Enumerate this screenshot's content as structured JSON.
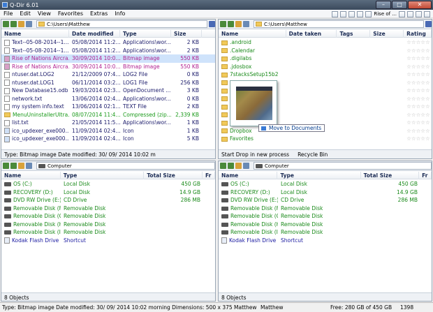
{
  "app": {
    "title": "Q-Dir 6.01"
  },
  "menu": [
    "File",
    "Edit",
    "View",
    "Favorites",
    "Extras",
    "Info"
  ],
  "top_toolbar": {
    "rise_label": "Rise of ..."
  },
  "colors": {
    "exe": "#1a1aa0",
    "bitmap": "#b02090",
    "app": "#2a2a9a",
    "zip": "#1a9a1a",
    "drive": "#1a8a1a",
    "shortcut": "#1a1aa0",
    "default": "#1a1a6a",
    "selection": "#cfe3fb"
  },
  "pane_tl": {
    "address": "C:\\Users\\Matthew",
    "headers": {
      "name": "Name",
      "date": "Date modified",
      "type": "Type",
      "size": "Size"
    },
    "rows": [
      {
        "name": "Text--05-08-2014--1...",
        "date": "05/08/2014 11:2...",
        "type": "Applications\\wor...",
        "size": "2 KB",
        "kind": "text",
        "color": "#1a1a6a"
      },
      {
        "name": "Text--05-08-2014--1...",
        "date": "05/08/2014 11:2...",
        "type": "Applications\\wor...",
        "size": "2 KB",
        "kind": "text",
        "color": "#1a1a6a"
      },
      {
        "name": "Rise of Nations Aircra...",
        "date": "30/09/2014 10:0...",
        "type": "Bitmap image",
        "size": "550 KB",
        "kind": "bitmap",
        "color": "#b02090"
      },
      {
        "name": "Rise of Nations Aircra...",
        "date": "30/09/2014 10:0...",
        "type": "Bitmap image",
        "size": "550 KB",
        "kind": "bitmap",
        "color": "#b02090"
      },
      {
        "name": "ntuser.dat.LOG2",
        "date": "21/12/2009 07:4...",
        "type": "LOG2 File",
        "size": "0 KB",
        "kind": "file",
        "color": "#1a1a6a"
      },
      {
        "name": "ntuser.dat.LOG1",
        "date": "06/11/2014 03:2...",
        "type": "LOG1 File",
        "size": "256 KB",
        "kind": "file",
        "color": "#1a1a6a"
      },
      {
        "name": "New Database15.odb",
        "date": "19/03/2014 02:3...",
        "type": "OpenDocument ...",
        "size": "3 KB",
        "kind": "file",
        "color": "#1a1a6a"
      },
      {
        "name": "network.txt",
        "date": "13/06/2014 02:4...",
        "type": "Applications\\wor...",
        "size": "0 KB",
        "kind": "text",
        "color": "#1a1a6a"
      },
      {
        "name": "my system info.text",
        "date": "13/06/2014 02:1...",
        "type": "TEXT File",
        "size": "2 KB",
        "kind": "text",
        "color": "#1a1a6a"
      },
      {
        "name": "MenuUninstallerUltra...",
        "date": "08/07/2014 11:4...",
        "type": "Compressed (zip...",
        "size": "2,339 KB",
        "kind": "zip",
        "color": "#1a9a1a"
      },
      {
        "name": "list.txt",
        "date": "21/05/2014 11:5...",
        "type": "Applications\\wor...",
        "size": "1 KB",
        "kind": "text",
        "color": "#1a1a6a"
      },
      {
        "name": "ico_updexer_exe000...",
        "date": "11/09/2014 02:4...",
        "type": "Icon",
        "size": "1 KB",
        "kind": "icon",
        "color": "#1a1a6a"
      },
      {
        "name": "ico_updexer_exe000...",
        "date": "11/09/2014 02:4...",
        "type": "Icon",
        "size": "5 KB",
        "kind": "icon",
        "color": "#1a1a6a"
      }
    ],
    "status": "Type: Bitmap image Date modified: 30/ 09/ 2014  10:02 m"
  },
  "pane_tr": {
    "address": "C:\\Users\\Matthew",
    "headers": {
      "name": "Name",
      "date": "Date taken",
      "tags": "Tags",
      "size": "Size",
      "rating": "Rating"
    },
    "rows": [
      {
        "name": ".android",
        "color": "#1a8a1a"
      },
      {
        "name": ".Calendar",
        "color": "#1a8a1a"
      },
      {
        "name": ".digilabs",
        "color": "#1a8a1a"
      },
      {
        "name": ".jdosbox",
        "color": "#1a8a1a"
      },
      {
        "name": "7stacksSetup15b2",
        "color": "#1a8a1a"
      },
      {
        "name": "AppData",
        "color": "#3aa83a"
      },
      {
        "name": "C",
        "color": "#1a8a1a"
      },
      {
        "name": "d",
        "color": "#1a8a1a"
      },
      {
        "name": "D",
        "color": "#1a8a1a"
      },
      {
        "name": "D",
        "color": "#1a8a1a"
      },
      {
        "name": "Downloads",
        "color": "#1a8a1a"
      },
      {
        "name": "Dropbox",
        "color": "#1a8a1a"
      },
      {
        "name": "Favorites",
        "color": "#1a8a1a"
      }
    ],
    "drag_tip": "Move to Documents",
    "status_left": "Start Drop in new process",
    "status_right": "Recycle Bin"
  },
  "pane_bl": {
    "address": "Computer",
    "headers": {
      "name": "Name",
      "type": "Type",
      "total": "Total Size",
      "fr": "Fr"
    },
    "rows": [
      {
        "name": "OS (C:)",
        "type": "Local Disk",
        "size": "450 GB",
        "kind": "drive",
        "color": "#1a8a1a"
      },
      {
        "name": "RECOVERY (D:)",
        "type": "Local Disk",
        "size": "14.9 GB",
        "kind": "drive",
        "color": "#1a8a1a"
      },
      {
        "name": "DVD RW Drive (E:)",
        "type": "CD Drive",
        "size": "286 MB",
        "kind": "drive",
        "color": "#1a8a1a"
      },
      {
        "name": "Removable Disk (F:)",
        "type": "Removable Disk",
        "size": "",
        "kind": "drive",
        "color": "#1a8a1a"
      },
      {
        "name": "Removable Disk (G:)",
        "type": "Removable Disk",
        "size": "",
        "kind": "drive",
        "color": "#1a8a1a"
      },
      {
        "name": "Removable Disk (H:)",
        "type": "Removable Disk",
        "size": "",
        "kind": "drive",
        "color": "#1a8a1a"
      },
      {
        "name": "Removable Disk (I:)",
        "type": "Removable Disk",
        "size": "",
        "kind": "drive",
        "color": "#1a8a1a"
      },
      {
        "name": "Kodak Flash Drive",
        "type": "Shortcut",
        "size": "",
        "kind": "shortcut",
        "color": "#1a1aa0"
      }
    ],
    "status": "8 Objects"
  },
  "pane_br": {
    "address": "Computer",
    "headers": {
      "name": "Name",
      "type": "Type",
      "total": "Total Size",
      "fr": "Fr"
    },
    "rows": [
      {
        "name": "OS (C:)",
        "type": "Local Disk",
        "size": "450 GB",
        "kind": "drive",
        "color": "#1a8a1a"
      },
      {
        "name": "RECOVERY (D:)",
        "type": "Local Disk",
        "size": "14.9 GB",
        "kind": "drive",
        "color": "#1a8a1a"
      },
      {
        "name": "DVD RW Drive (E:)",
        "type": "CD Drive",
        "size": "286 MB",
        "kind": "drive",
        "color": "#1a8a1a"
      },
      {
        "name": "Removable Disk (F:)",
        "type": "Removable Disk",
        "size": "",
        "kind": "drive",
        "color": "#1a8a1a"
      },
      {
        "name": "Removable Disk (G:)",
        "type": "Removable Disk",
        "size": "",
        "kind": "drive",
        "color": "#1a8a1a"
      },
      {
        "name": "Removable Disk (H:)",
        "type": "Removable Disk",
        "size": "",
        "kind": "drive",
        "color": "#1a8a1a"
      },
      {
        "name": "Removable Disk (I:)",
        "type": "Removable Disk",
        "size": "",
        "kind": "drive",
        "color": "#1a8a1a"
      },
      {
        "name": "Kodak Flash Drive",
        "type": "Shortcut",
        "size": "",
        "kind": "shortcut",
        "color": "#1a1aa0"
      }
    ],
    "status": "8 Objects"
  },
  "statusbar": {
    "left": "Type: Bitmap image Date modified: 30/ 09/ 2014  10:02 morning Dimensions: 500 x 375 Matthew",
    "folder": "Matthew",
    "free": "Free: 280 GB of 450 GB",
    "count": "1398"
  }
}
